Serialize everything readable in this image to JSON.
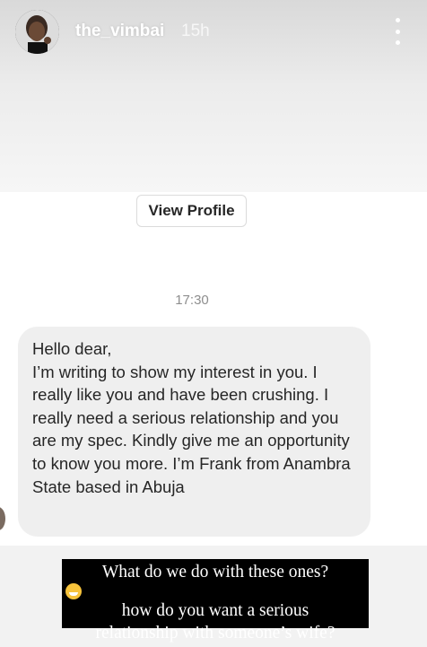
{
  "header": {
    "username": "the_vimbai",
    "time_ago": "15h",
    "more_icon": "more-vertical-icon"
  },
  "profile": {
    "view_profile_label": "View Profile"
  },
  "chat": {
    "timestamp": "17:30",
    "message": "Hello dear,\nI’m writing to show my interest in you. I really like you and have been crushing. I really need a serious relationship and you are my spec. Kindly give me an opportunity to know you more. I’m Frank from Anambra State based in Abuja"
  },
  "caption": {
    "line1": "What do we do with these ones?",
    "emoji": "grinning-sweat-face",
    "line2": "how do you want a serious",
    "line3": "relationship with someone’s wife?"
  }
}
